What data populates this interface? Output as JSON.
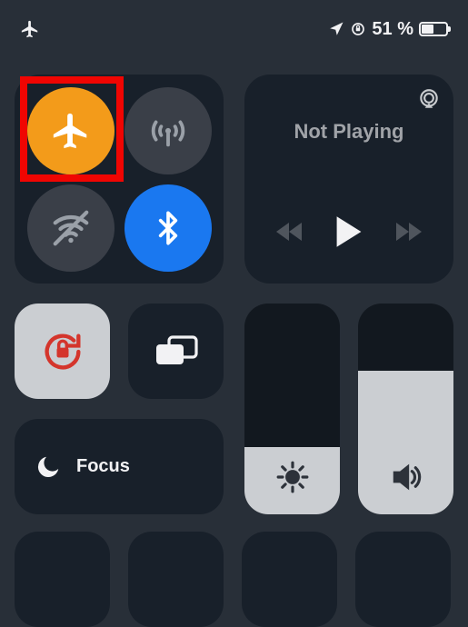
{
  "status_bar": {
    "airplane_mode": true,
    "location_active": true,
    "orientation_locked": true,
    "battery_percent_text": "51 %",
    "battery_fill_percent": 51
  },
  "connectivity": {
    "airplane": {
      "active": true,
      "color": "#f39b1a"
    },
    "cellular": {
      "active": false,
      "color": "#3a3f48"
    },
    "wifi": {
      "active": false,
      "color": "#3a3f48"
    },
    "bluetooth": {
      "active": true,
      "color": "#1a78f0"
    }
  },
  "highlight": {
    "target": "airplane-mode-toggle"
  },
  "media": {
    "title": "Not Playing",
    "prev_enabled": false,
    "next_enabled": false
  },
  "orientation_lock": {
    "locked": true
  },
  "screen_mirroring": {
    "label": "Screen Mirroring"
  },
  "focus": {
    "label": "Focus",
    "active": false
  },
  "brightness": {
    "level_percent": 32
  },
  "volume": {
    "level_percent": 68
  }
}
